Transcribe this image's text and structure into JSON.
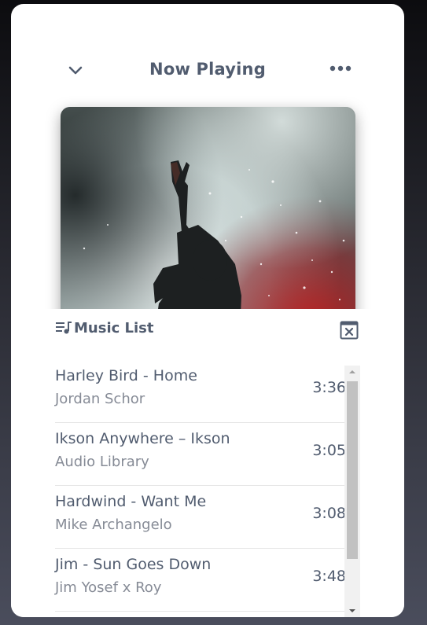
{
  "header": {
    "title": "Now Playing",
    "collapse_icon": "chevron-down-icon",
    "more_icon": "more-horizontal-icon"
  },
  "album_art": {
    "description_icon": "album-cover-image"
  },
  "music_list": {
    "title": "Music List",
    "list_icon": "queue-music-icon",
    "close_icon": "close-box-icon",
    "tracks": [
      {
        "name": "Harley Bird - Home",
        "artist": "Jordan Schor",
        "duration": "3:36"
      },
      {
        "name": "Ikson Anywhere – Ikson",
        "artist": "Audio Library",
        "duration": "3:05"
      },
      {
        "name": "Hardwind - Want Me",
        "artist": "Mike Archangelo",
        "duration": "3:08"
      },
      {
        "name": "Jim - Sun Goes Down",
        "artist": "Jim Yosef x Roy",
        "duration": "3:48"
      }
    ]
  },
  "colors": {
    "text_primary": "#515c6f",
    "text_secondary": "#868b96",
    "card_background": "#ffffff"
  }
}
